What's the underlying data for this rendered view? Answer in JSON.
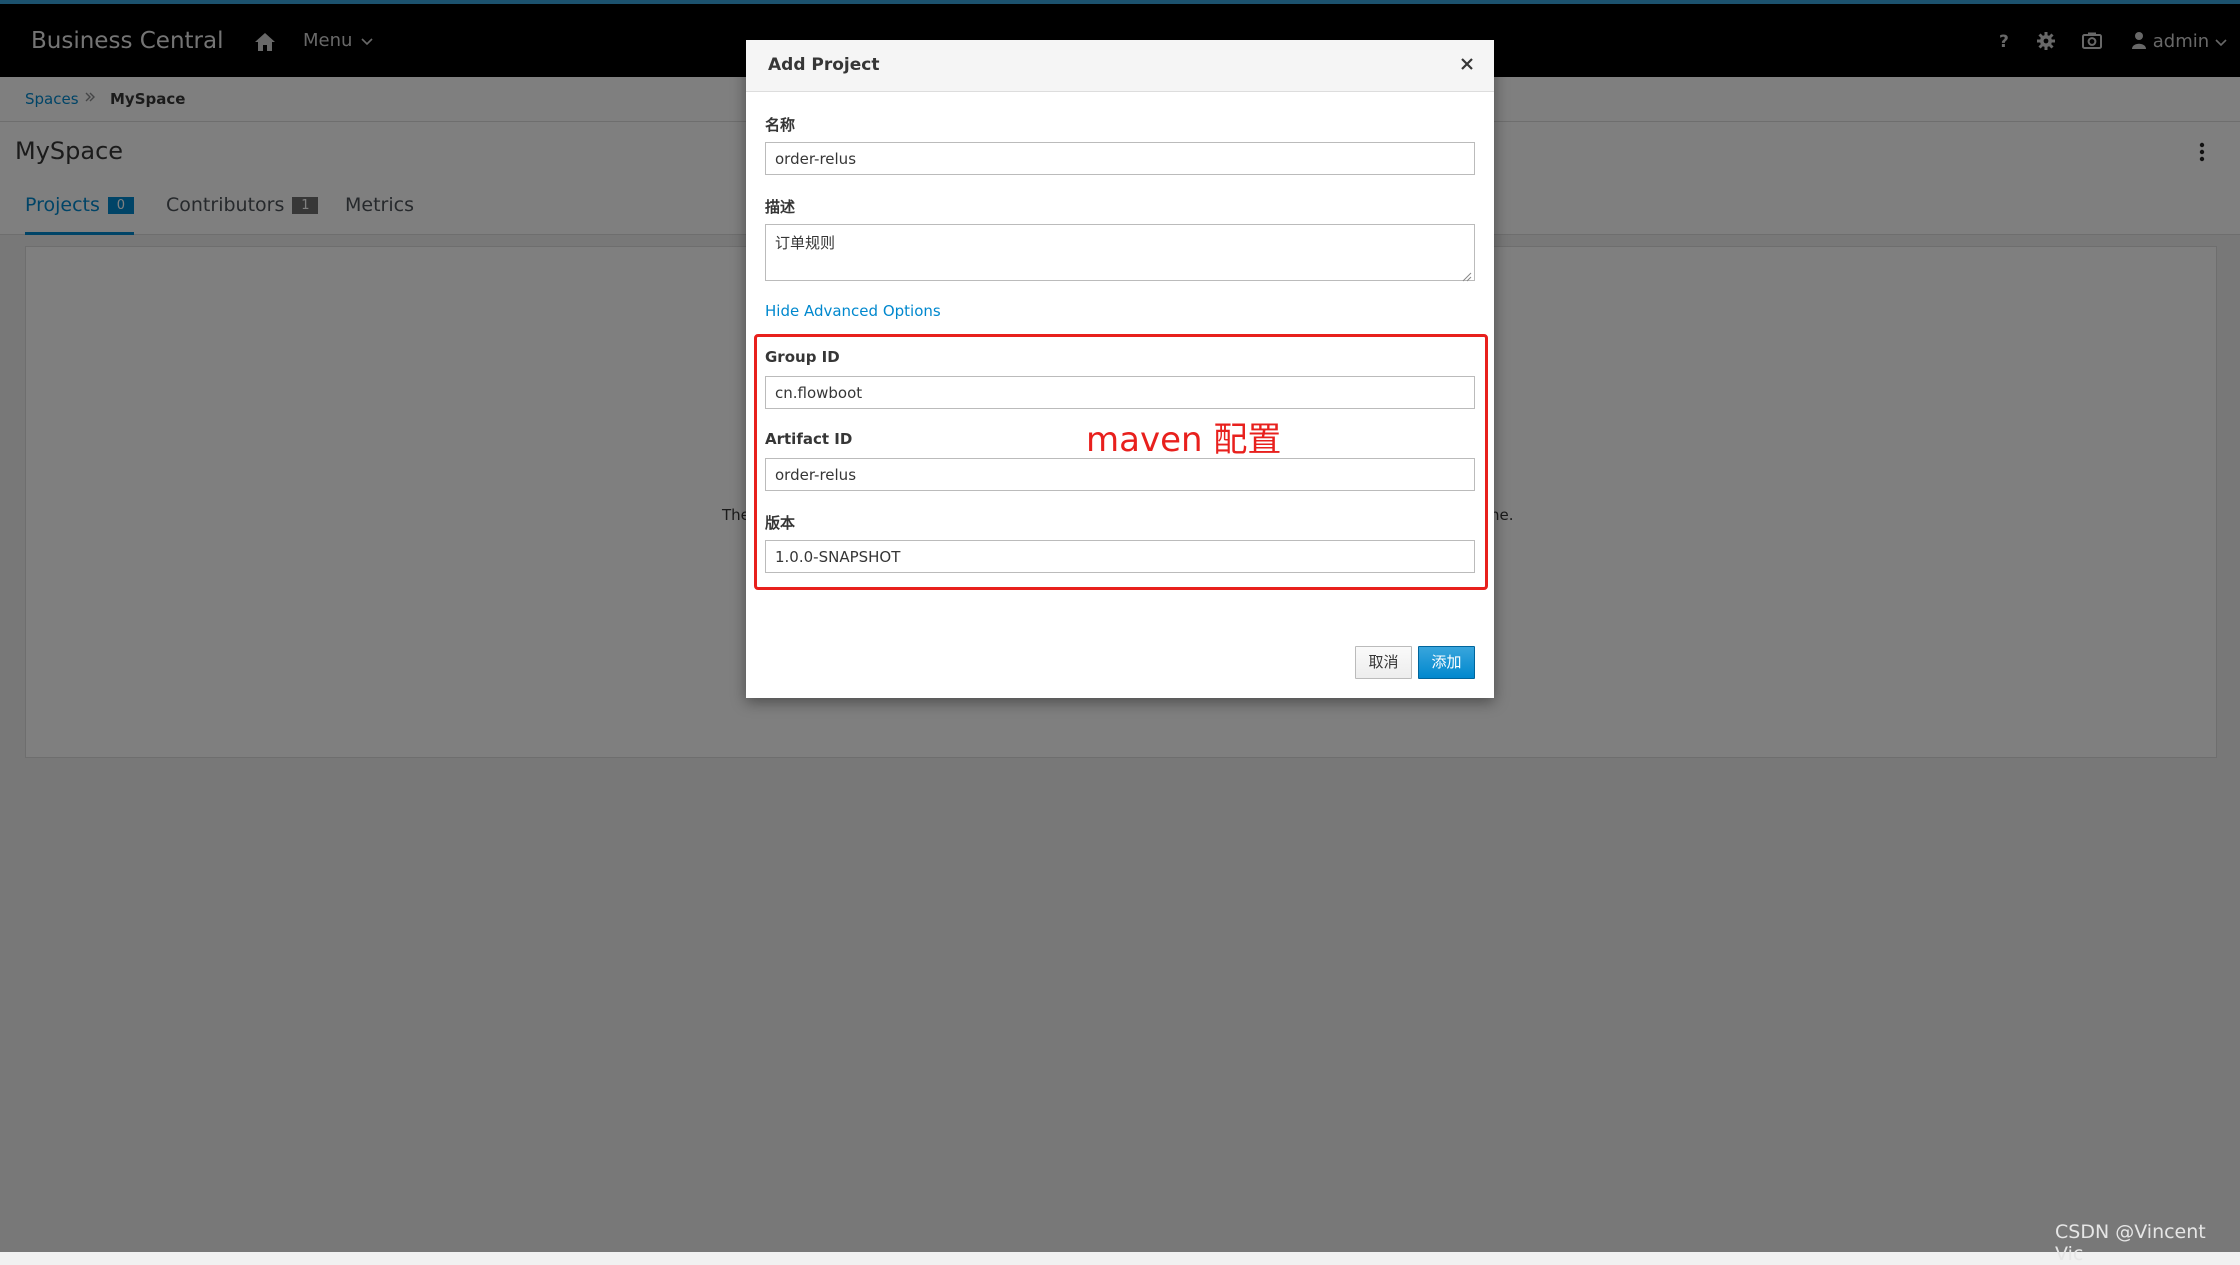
{
  "nav": {
    "brand": "Business Central",
    "home_icon": "home-icon",
    "menu_label": "Menu",
    "help_icon": "help-icon",
    "settings_icon": "gear-icon",
    "camera_icon": "camera-icon",
    "user_label": "admin"
  },
  "breadcrumb": {
    "spaces": "Spaces",
    "current": "MySpace"
  },
  "page": {
    "title": "MySpace"
  },
  "tabs": [
    {
      "label": "Projects",
      "count": "0"
    },
    {
      "label": "Contributors",
      "count": "1"
    },
    {
      "label": "Metrics"
    }
  ],
  "empty_state": {
    "left_fragment": "The",
    "right_fragment": "ne."
  },
  "modal": {
    "title": "Add Project",
    "name_label": "名称",
    "name_value": "order-relus",
    "description_label": "描述",
    "description_value": "订单规则",
    "advanced_link": "Hide Advanced Options",
    "group_label": "Group ID",
    "group_value": "cn.flowboot",
    "artifact_label": "Artifact ID",
    "artifact_value": "order-relus",
    "version_label": "版本",
    "version_value": "1.0.0-SNAPSHOT",
    "cancel_label": "取消",
    "add_label": "添加"
  },
  "annotation": {
    "text": "maven 配置",
    "color": "#e8201d"
  },
  "watermark": "CSDN @Vincent Vic",
  "colors": {
    "accent": "#0088ce",
    "navbar": "#000000",
    "overlay": "rgba(0,0,0,0.5)"
  }
}
